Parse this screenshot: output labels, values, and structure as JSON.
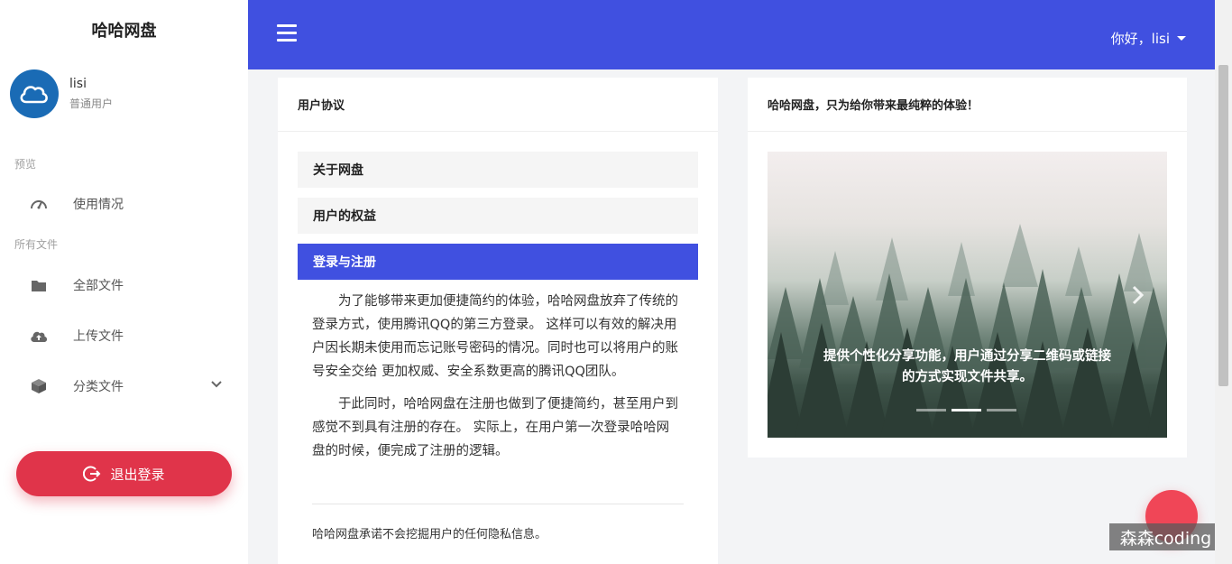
{
  "sidebar": {
    "brand": "哈哈网盘",
    "user": {
      "name": "lisi",
      "role": "普通用户"
    },
    "sections": [
      {
        "label": "预览"
      },
      {
        "label": "所有文件"
      }
    ],
    "items": [
      {
        "label": "使用情况",
        "icon": "dashboard-gauge-icon"
      },
      {
        "label": "全部文件",
        "icon": "folder-icon"
      },
      {
        "label": "上传文件",
        "icon": "cloud-upload-icon"
      },
      {
        "label": "分类文件",
        "icon": "cube-icon"
      }
    ],
    "logout_label": "退出登录"
  },
  "header": {
    "greeting": "你好，lisi"
  },
  "agreement": {
    "title": "用户协议",
    "accordion": [
      {
        "label": "关于网盘"
      },
      {
        "label": "用户的权益"
      },
      {
        "label": "登录与注册"
      }
    ],
    "paragraphs": [
      "为了能够带来更加便捷简约的体验，哈哈网盘放弃了传统的登录方式，使用腾讯QQ的第三方登录。 这样可以有效的解决用户因长期未使用而忘记账号密码的情况。同时也可以将用户的账号安全交给 更加权威、安全系数更高的腾讯QQ团队。",
      "于此同时，哈哈网盘在注册也做到了便捷简约，甚至用户到感觉不到具有注册的存在。 实际上，在用户第一次登录哈哈网盘的时候，便完成了注册的逻辑。"
    ],
    "footnote": "哈哈网盘承诺不会挖掘用户的任何隐私信息。"
  },
  "showcase": {
    "title": "哈哈网盘，只为给你带来最纯粹的体验！",
    "caption": "提供个性化分享功能，用户通过分享二维码或链接的方式实现文件共享。",
    "slide_count": 3,
    "active_slide": 2
  },
  "watermark": "森森coding",
  "colors": {
    "primary": "#4050e0",
    "danger": "#e0344a",
    "avatar": "#1a6bb5"
  }
}
